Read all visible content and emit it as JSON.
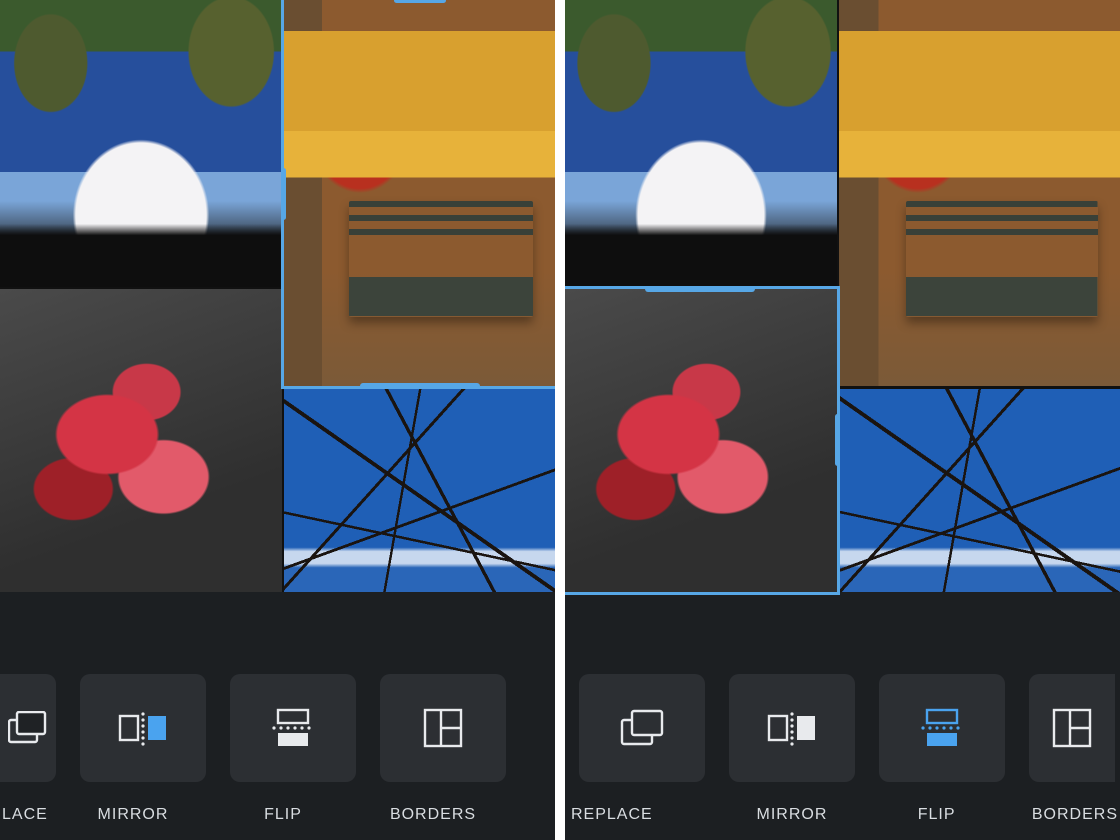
{
  "accent": "#57a7e6",
  "panes": [
    {
      "id": "left",
      "selected_tile": "top-right",
      "active_tool": "mirror",
      "toolbar": {
        "scroll_cut": "left",
        "buttons": [
          {
            "name": "replace",
            "label": "LACE",
            "label_full": "REPLACE"
          },
          {
            "name": "mirror",
            "label": "MIRROR"
          },
          {
            "name": "flip",
            "label": "FLIP"
          },
          {
            "name": "borders",
            "label": "BORDERS"
          }
        ]
      }
    },
    {
      "id": "right",
      "selected_tile": "bottom-left",
      "active_tool": "flip",
      "toolbar": {
        "scroll_cut": "right",
        "buttons": [
          {
            "name": "replace",
            "label": "REPLACE"
          },
          {
            "name": "mirror",
            "label": "MIRROR"
          },
          {
            "name": "flip",
            "label": "FLIP"
          },
          {
            "name": "borders",
            "label": "BORDERS"
          }
        ]
      }
    }
  ],
  "collage": {
    "tiles": [
      {
        "id": "top-left",
        "photo": "sky-tree"
      },
      {
        "id": "top-right",
        "photo": "bench"
      },
      {
        "id": "bottom-left",
        "photo": "leaves"
      },
      {
        "id": "bottom-right",
        "photo": "branches"
      }
    ]
  }
}
